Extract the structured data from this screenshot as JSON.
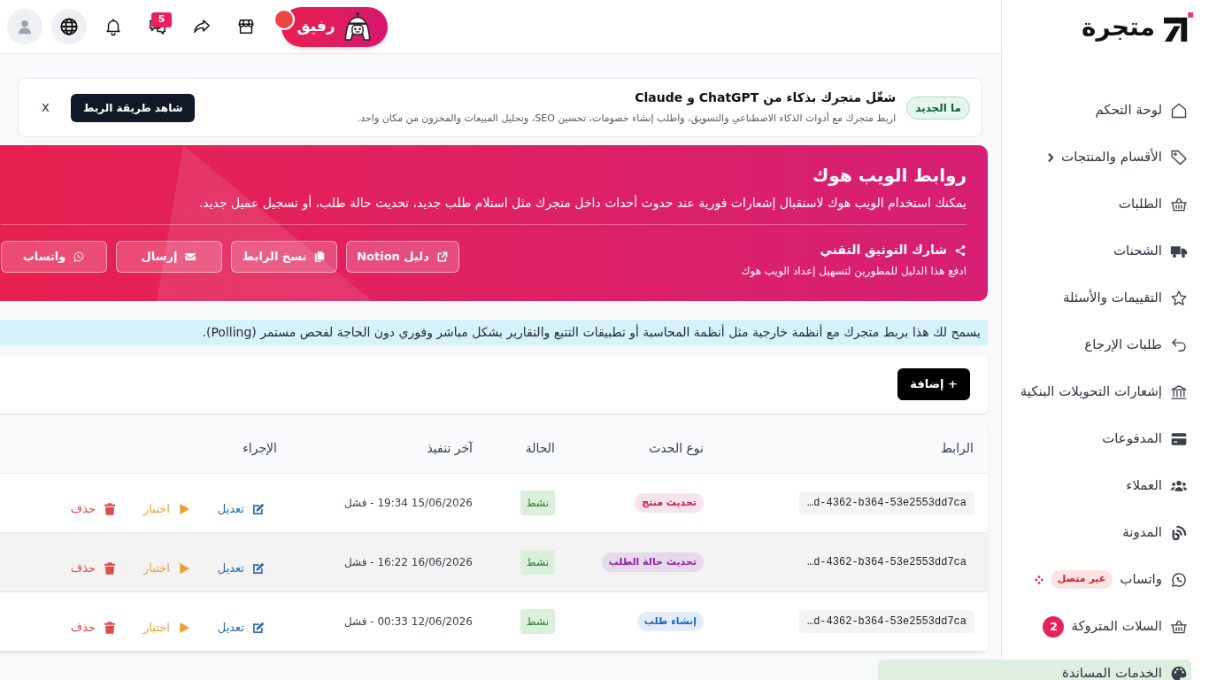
{
  "sidebar": {
    "logo": "متجرة",
    "items": [
      {
        "label": "لوحة التحكم",
        "kind": "link"
      },
      {
        "label": "الأقسام والمنتجات",
        "kind": "group",
        "expanded": false
      },
      {
        "label": "الطلبات",
        "kind": "link"
      },
      {
        "label": "الشحنات",
        "kind": "link"
      },
      {
        "label": "التقييمات والأسئلة",
        "kind": "link"
      },
      {
        "label": "طلبات الإرجاع",
        "kind": "link"
      },
      {
        "label": "إشعارات التحويلات البنكية",
        "kind": "link"
      },
      {
        "label": "المدفوعات",
        "kind": "link"
      },
      {
        "label": "العملاء",
        "kind": "link"
      },
      {
        "label": "المدونة",
        "kind": "link"
      },
      {
        "label": "واتساب",
        "kind": "status",
        "badge": "غير متصل",
        "connected": false
      },
      {
        "label": "السلات المتروكة",
        "kind": "count",
        "count": "2"
      },
      {
        "label": "الخدمات المساندة",
        "kind": "link"
      }
    ]
  },
  "topbar": {
    "assistant": {
      "label": "رفيق",
      "notification": true
    },
    "messages_count": "5"
  },
  "banner": {
    "badge": "ما الجديد",
    "title": "شغّل متجرك بذكاء من ChatGPT و Claude",
    "text": "اربط متجرك مع أدوات الذكاء الاصطناعي والتسويق، واطلب إنشاء خصومات، تحسين SEO، وتحليل المبيعات والمخزون من مكان واحد.",
    "button": "شاهد طريقة الربط",
    "close": "x"
  },
  "hero": {
    "title": "روابط الويب هوك",
    "text": "يمكنك استخدام الويب هوك لاستقبال إشعارات فورية عند حدوث أحداث داخل متجرك مثل استلام طلب جديد، تحديث حالة طلب، أو تسجيل عميل جديد.",
    "share_title": "شارك التوثيق التقني",
    "share_text": "ادفع هذا الدليل للمطورين لتسهيل إعداد الويب هوك",
    "buttons": [
      {
        "label": "دليل Notion",
        "kind": "external"
      },
      {
        "label": "نسخ الرابط",
        "kind": "copy"
      },
      {
        "label": "إرسال",
        "kind": "email"
      },
      {
        "label": "واتساب",
        "kind": "whatsapp"
      }
    ]
  },
  "info": "يسمح لك هذا بربط متجرك مع أنظمة خارجية مثل أنظمة المحاسبة أو تطبيقات التتبع والتقارير بشكل مباشر وفوري دون الحاجة لفحص مستمر (Polling).",
  "add_button": "+ إضافة",
  "table": {
    "columns": [
      "الرابط",
      "نوع الحدث",
      "الحالة",
      "آخر تنفيذ",
      "الإجراء"
    ],
    "rows": [
      {
        "url": "…d-4362-b364-53e2553dd7ca",
        "event": {
          "label": "تحديث منتج",
          "color": "#c2185b"
        },
        "status": {
          "label": "نشط",
          "active": true
        },
        "last_run": "15/06/2026 19:34 - فشل",
        "highlighted": false,
        "actions": [
          {
            "label": "تعديل",
            "kind": "edit"
          },
          {
            "label": "اختبار",
            "kind": "test"
          },
          {
            "label": "حذف",
            "kind": "delete"
          }
        ]
      },
      {
        "url": "…d-4362-b364-53e2553dd7ca",
        "event": {
          "label": "تحديث حالة الطلب",
          "color": "#8e24aa"
        },
        "status": {
          "label": "نشط",
          "active": true
        },
        "last_run": "16/06/2026 16:22 - فشل",
        "highlighted": true,
        "actions": [
          {
            "label": "تعديل",
            "kind": "edit"
          },
          {
            "label": "اختبار",
            "kind": "test"
          },
          {
            "label": "حذف",
            "kind": "delete"
          }
        ]
      },
      {
        "url": "…d-4362-b364-53e2553dd7ca",
        "event": {
          "label": "إنشاء طلب",
          "color": "#1565c0"
        },
        "status": {
          "label": "نشط",
          "active": true
        },
        "last_run": "12/06/2026 00:33 - فشل",
        "highlighted": false,
        "actions": [
          {
            "label": "تعديل",
            "kind": "edit"
          },
          {
            "label": "اختبار",
            "kind": "test"
          },
          {
            "label": "حذف",
            "kind": "delete"
          }
        ]
      }
    ]
  }
}
